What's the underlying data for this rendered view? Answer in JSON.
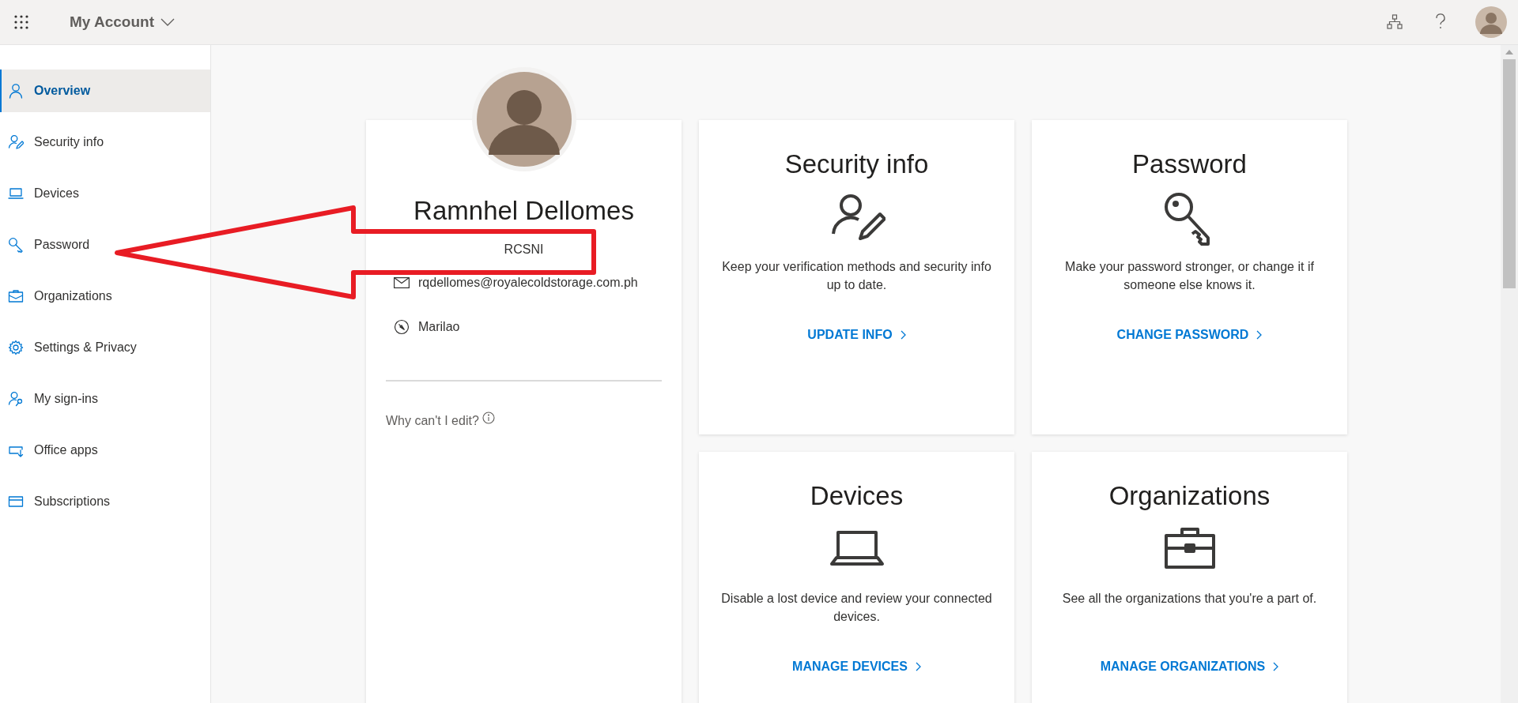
{
  "header": {
    "app_title": "My Account"
  },
  "sidebar": {
    "items": [
      {
        "label": "Overview",
        "selected": true
      },
      {
        "label": "Security info",
        "selected": false
      },
      {
        "label": "Devices",
        "selected": false
      },
      {
        "label": "Password",
        "selected": false
      },
      {
        "label": "Organizations",
        "selected": false
      },
      {
        "label": "Settings & Privacy",
        "selected": false
      },
      {
        "label": "My sign-ins",
        "selected": false
      },
      {
        "label": "Office apps",
        "selected": false
      },
      {
        "label": "Subscriptions",
        "selected": false
      }
    ]
  },
  "profile": {
    "name": "Ramnhel Dellomes",
    "organization": "RCSNI",
    "email": "rqdellomes@royalecoldstorage.com.ph",
    "location": "Marilao",
    "note": "Why can't I edit?"
  },
  "cards": [
    {
      "title": "Security info",
      "description": "Keep your verification methods and security info up to date.",
      "link": "UPDATE INFO"
    },
    {
      "title": "Password",
      "description": "Make your password stronger, or change it if someone else knows it.",
      "link": "CHANGE PASSWORD"
    },
    {
      "title": "Devices",
      "description": "Disable a lost device and review your connected devices.",
      "link": "MANAGE DEVICES"
    },
    {
      "title": "Organizations",
      "description": "See all the organizations that you're a part of.",
      "link": "MANAGE ORGANIZATIONS"
    }
  ],
  "annotation": {
    "kind": "outline-arrow"
  }
}
